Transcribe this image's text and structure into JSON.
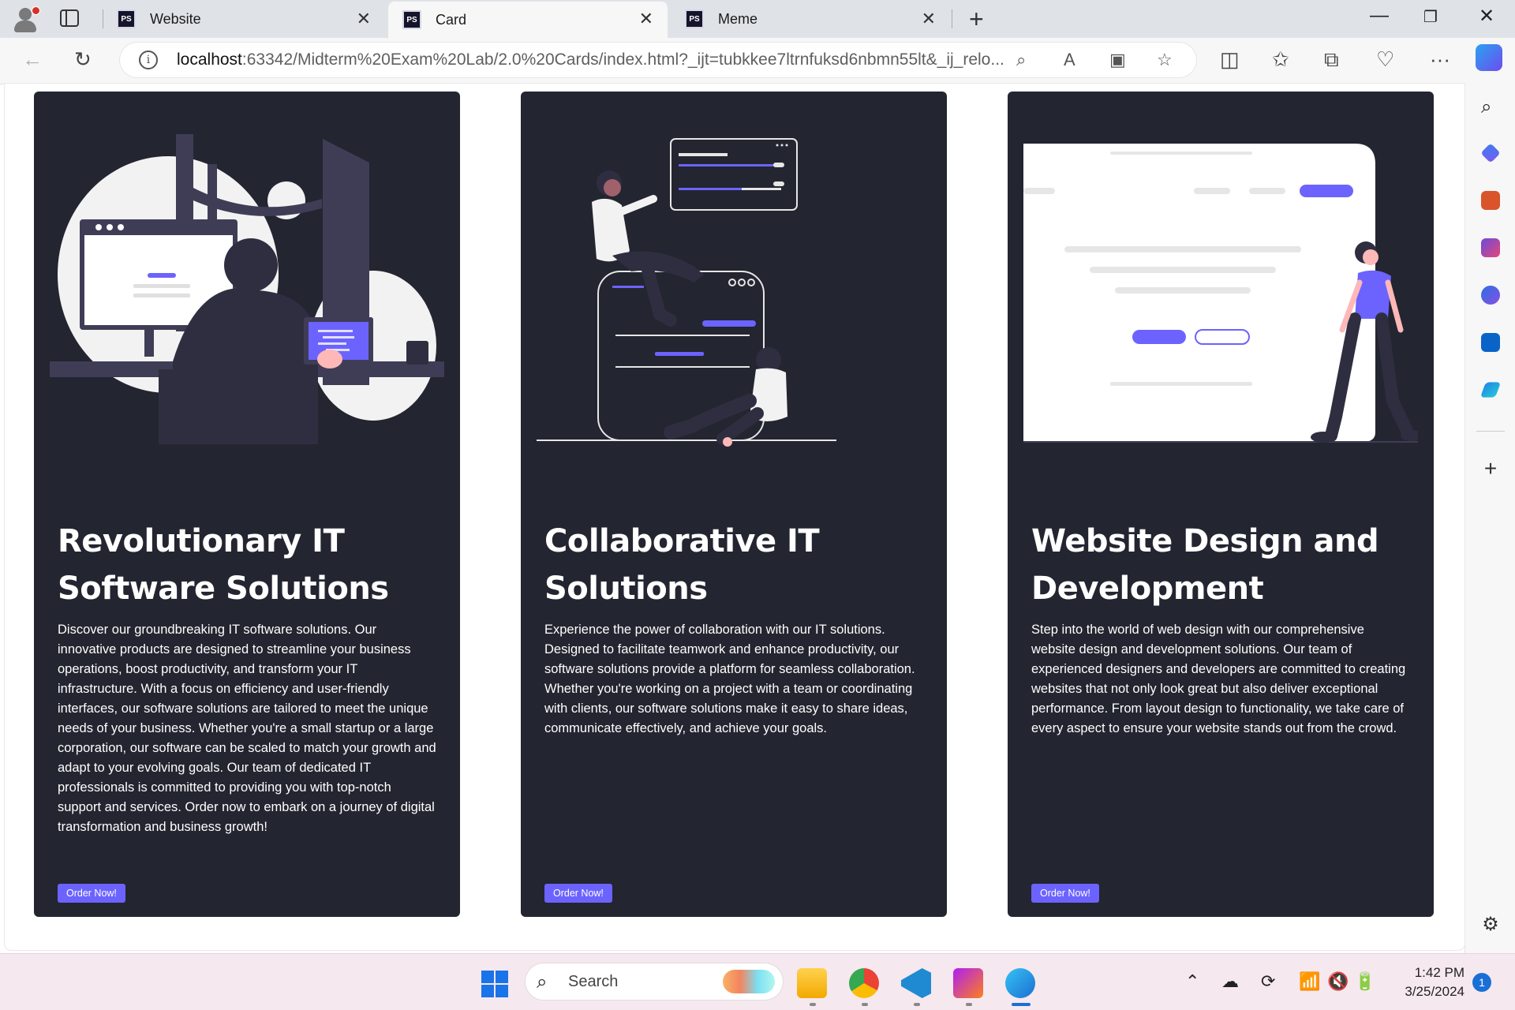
{
  "browser": {
    "tabs": [
      {
        "title": "Website",
        "icon": "phpstorm-icon",
        "active": false
      },
      {
        "title": "Card",
        "icon": "phpstorm-icon",
        "active": true
      },
      {
        "title": "Meme",
        "icon": "phpstorm-icon",
        "active": false
      }
    ],
    "address": {
      "host": "localhost",
      "path": ":63342/Midterm%20Exam%20Lab/2.0%20Cards/index.html?_ijt=tubkkee7ltrnfuksd6nbmn55lt&_ij_relo..."
    }
  },
  "cards": [
    {
      "title": "Revolutionary IT Software Solutions",
      "description": "Discover our groundbreaking IT software solutions. Our innovative products are designed to streamline your business operations, boost productivity, and transform your IT infrastructure. With a focus on efficiency and user-friendly interfaces, our software solutions are tailored to meet the unique needs of your business. Whether you're a small startup or a large corporation, our software can be scaled to match your growth and adapt to your evolving goals. Our team of dedicated IT professionals is committed to providing you with top-notch support and services. Order now to embark on a journey of digital transformation and business growth!",
      "button": "Order Now!",
      "illustration": "developer-at-computer-illustration"
    },
    {
      "title": "Collaborative IT Solutions",
      "description": "Experience the power of collaboration with our IT solutions. Designed to facilitate teamwork and enhance productivity, our software solutions provide a platform for seamless collaboration. Whether you're working on a project with a team or coordinating with clients, our software solutions make it easy to share ideas, communicate effectively, and achieve your goals.",
      "button": "Order Now!",
      "illustration": "team-collaboration-illustration"
    },
    {
      "title": "Website Design and Development",
      "description": "Step into the world of web design with our comprehensive website design and development solutions. Our team of experienced designers and developers are committed to creating websites that not only look great but also deliver exceptional performance. From layout design to functionality, we take care of every aspect to ensure your website stands out from the crowd.",
      "button": "Order Now!",
      "illustration": "website-mockup-illustration"
    }
  ],
  "taskbar": {
    "search_label": "Search",
    "time": "1:42 PM",
    "date": "3/25/2024",
    "notification_count": "1"
  },
  "colors": {
    "card_bg": "#232530",
    "accent": "#6c63ff",
    "taskbar_bg": "#f6e8ef"
  }
}
